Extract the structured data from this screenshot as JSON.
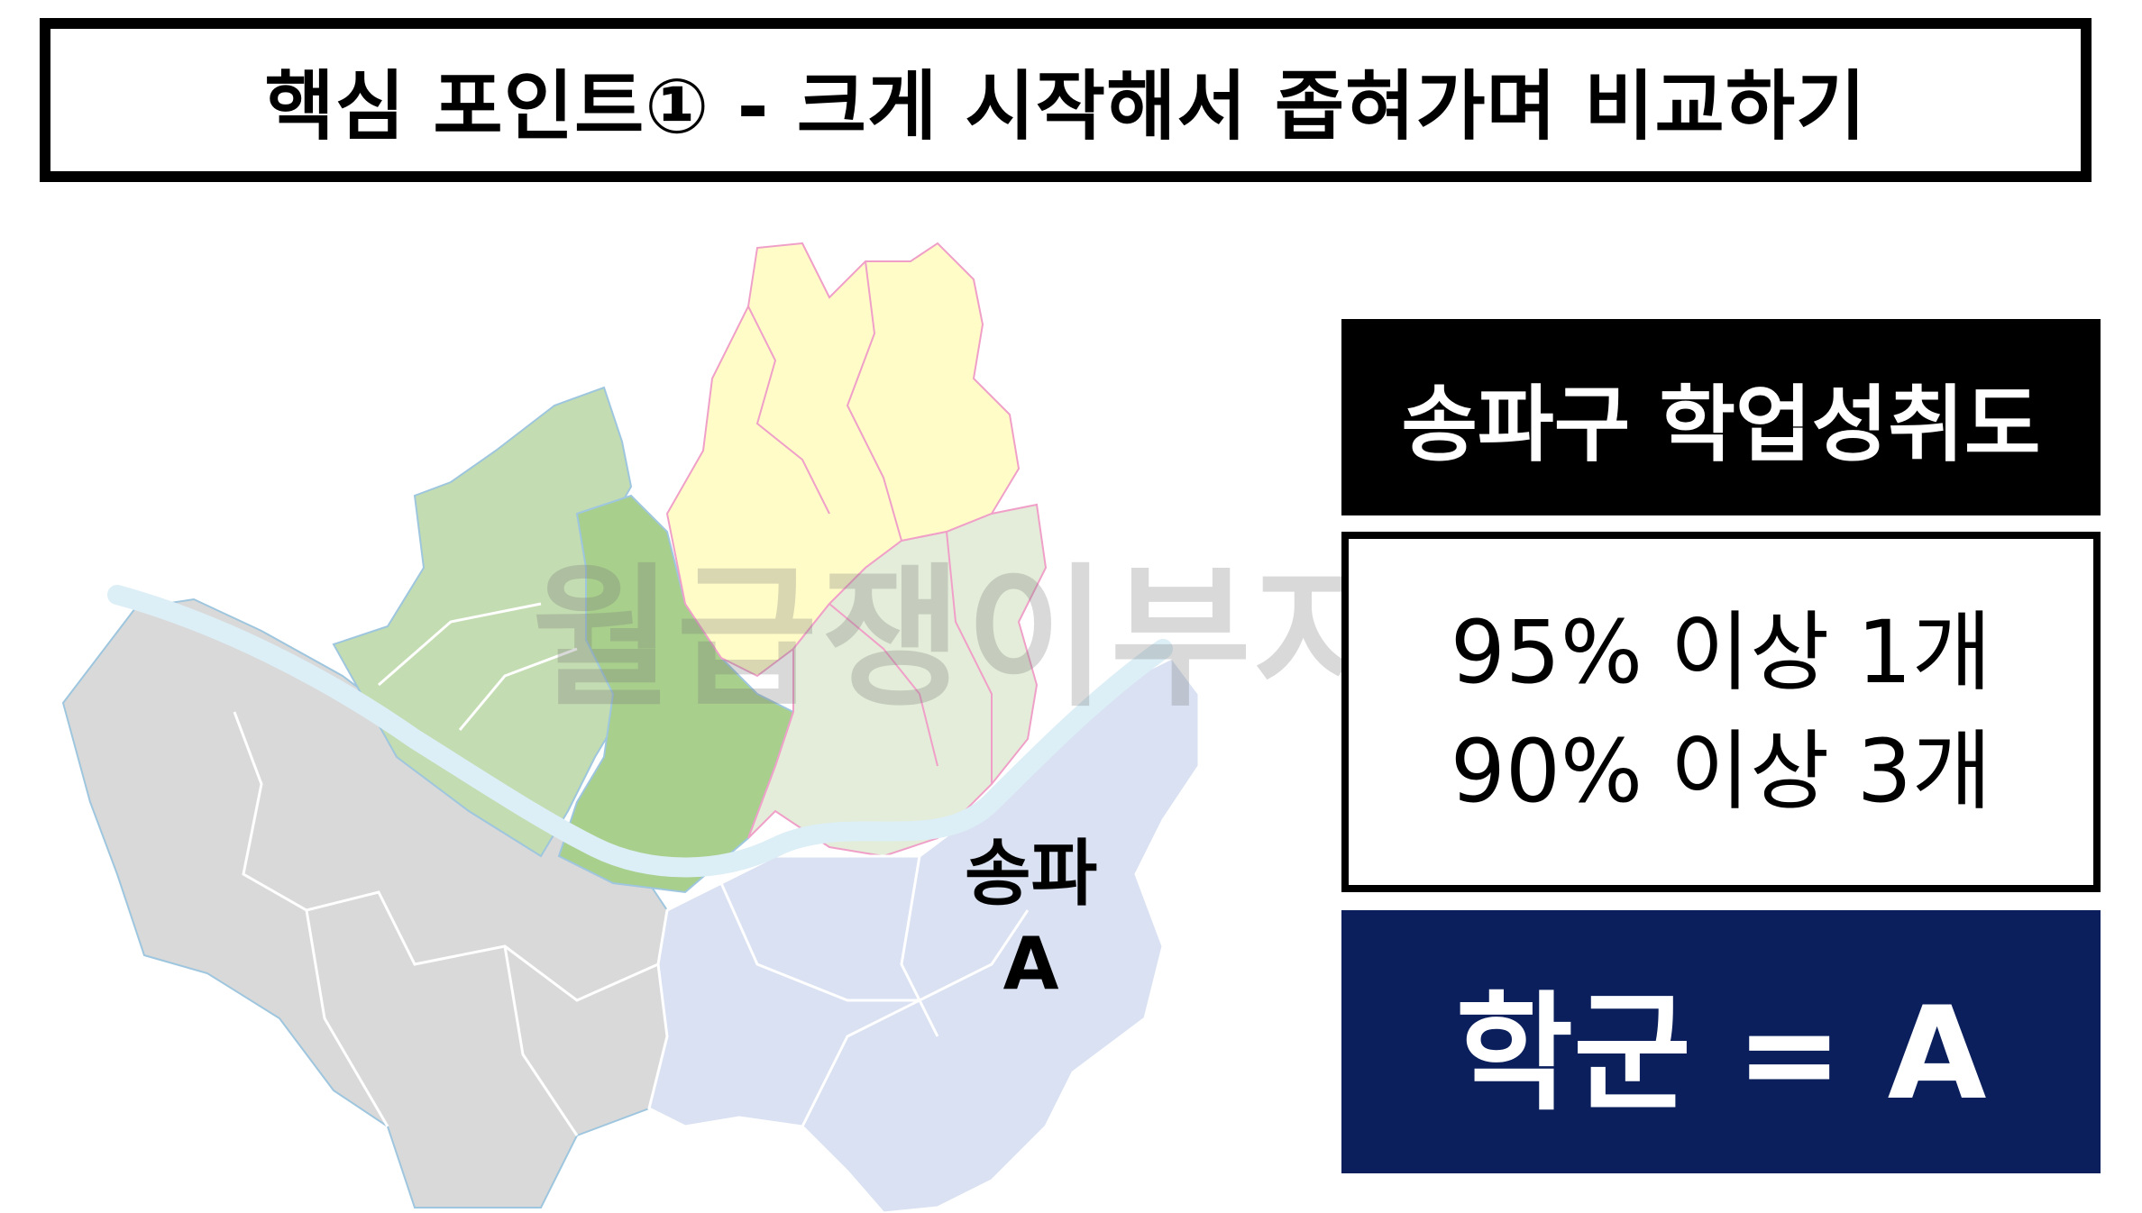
{
  "title": "핵심 포인트① - 크게 시작해서 좁혀가며 비교하기",
  "map": {
    "label_district": "송파",
    "label_grade": "A",
    "watermark": "월급쟁이부자들",
    "colors": {
      "southwest": "#d9d9d9",
      "northwest": "#c3dcb1",
      "center": "#a8cf8c",
      "north": "#fffcc8",
      "northeast": "#e4edd9",
      "southeast": "#d9e1f2",
      "river": "#dceef6"
    }
  },
  "panel": {
    "header": "송파구 학업성취도",
    "stat_1": "95% 이상 1개",
    "stat_2": "90% 이상 3개",
    "result": "학군 = A",
    "header_color": "#000000",
    "result_color": "#0a1f5c"
  }
}
